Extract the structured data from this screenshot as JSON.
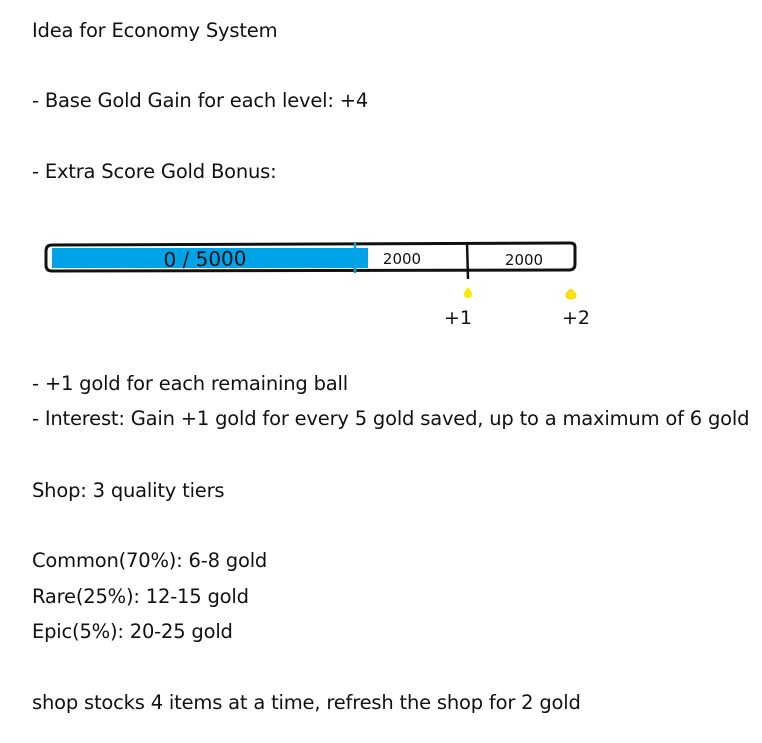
{
  "document": {
    "title": "Idea for Economy System",
    "base_gold": "- Base Gold Gain for each level: +4",
    "extra_score_heading": "- Extra Score Gold Bonus:",
    "remaining_ball": "- +1 gold for each remaining ball",
    "interest": "- Interest: Gain +1 gold for every 5 gold saved, up to a maximum of 6 gold",
    "shop_heading": "Shop: 3 quality tiers",
    "tiers": [
      "Common(70%): 6-8 gold",
      "Rare(25%): 12-15 gold",
      "Epic(5%): 20-25 gold"
    ],
    "shop_stock": "shop stocks 4 items at a time, refresh the shop for 2 gold"
  },
  "score_bar": {
    "progress_label": "0 / 5000",
    "segment_1_label": "2000",
    "segment_2_label": "2000",
    "marker_1_label": "+1",
    "marker_2_label": "+2",
    "fill_fraction": 0.61,
    "fill_color": "#00a2e8",
    "marker_color": "#ffe600"
  }
}
